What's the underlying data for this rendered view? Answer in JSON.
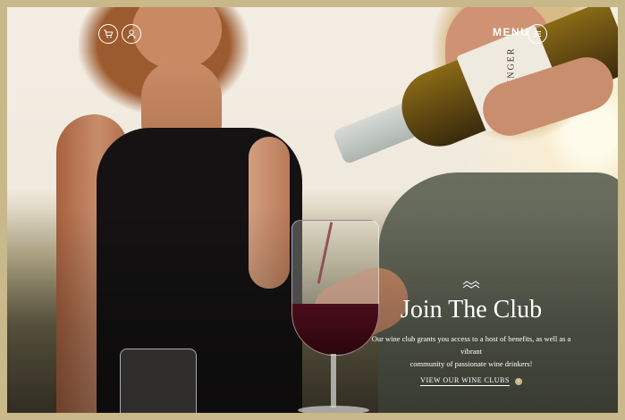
{
  "header": {
    "cart_icon": "shopping-cart-icon",
    "account_icon": "user-icon",
    "menu_label": "MENU",
    "menu_icon": "hamburger-icon"
  },
  "hero": {
    "bottle_label_text": "REININGER"
  },
  "promo": {
    "decor_icon": "wave-icon",
    "title": "Join The Club",
    "description_line1": "Our wine club grants you access to a host of benefits, as well as a vibrant",
    "description_line2": "community of passionate wine drinkers!",
    "cta_label": "VIEW OUR WINE CLUBS",
    "cta_icon": "arrow-right-icon"
  },
  "colors": {
    "frame": "#c8b88a",
    "accent": "#c8b88a",
    "side_tab": "#273444",
    "text_on_image": "#ffffff"
  }
}
